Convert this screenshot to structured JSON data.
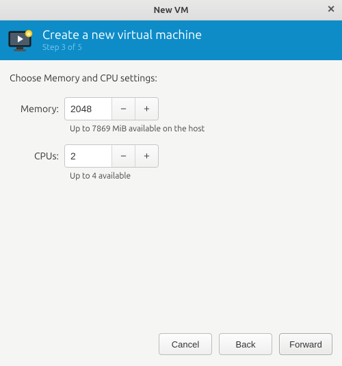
{
  "window": {
    "title": "New VM"
  },
  "header": {
    "title": "Create a new virtual machine",
    "step": "Step 3 of 5"
  },
  "content": {
    "prompt": "Choose Memory and CPU settings:",
    "memory": {
      "label": "Memory:",
      "value": "2048",
      "hint": "Up to 7869 MiB available on the host",
      "minus": "−",
      "plus": "+"
    },
    "cpus": {
      "label": "CPUs:",
      "value": "2",
      "hint": "Up to 4 available",
      "minus": "−",
      "plus": "+"
    }
  },
  "footer": {
    "cancel": "Cancel",
    "back": "Back",
    "forward": "Forward"
  }
}
